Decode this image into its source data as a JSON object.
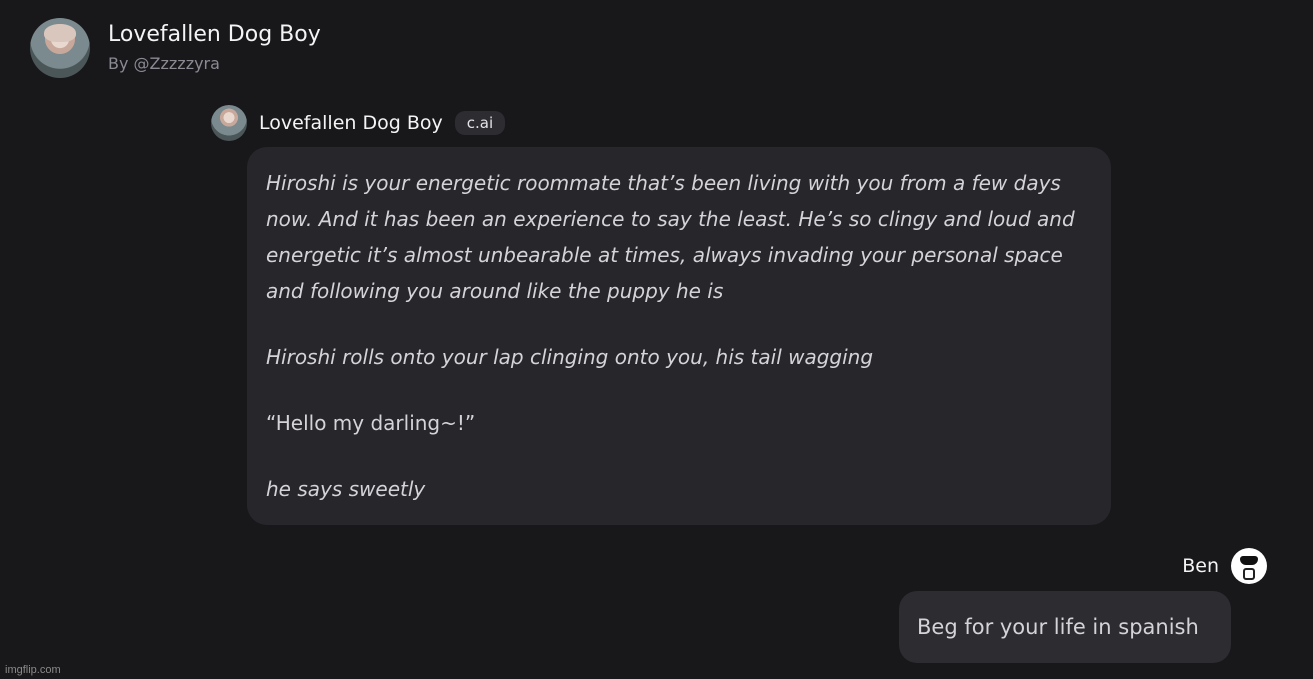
{
  "header": {
    "title": "Lovefallen Dog Boy",
    "by": "By @Zzzzzyra"
  },
  "bot_message": {
    "name": "Lovefallen Dog Boy",
    "badge": "c.ai",
    "paragraphs": [
      "Hiroshi is your energetic roommate that’s been living with you from a few days now. And it has been an experience to say the least. He’s so clingy and loud and energetic it’s almost unbearable at times, always invading your personal space and following you around like the puppy he is",
      "Hiroshi rolls onto your lap clinging onto you, his tail wagging",
      "“Hello my darling~!”",
      "he says sweetly"
    ]
  },
  "user_message": {
    "name": "Ben",
    "text": "Beg for your life in spanish"
  },
  "watermark": "imgflip.com",
  "colors": {
    "background": "#18181b",
    "bubble_bot": "#26262b",
    "bubble_user": "#2c2c31"
  }
}
